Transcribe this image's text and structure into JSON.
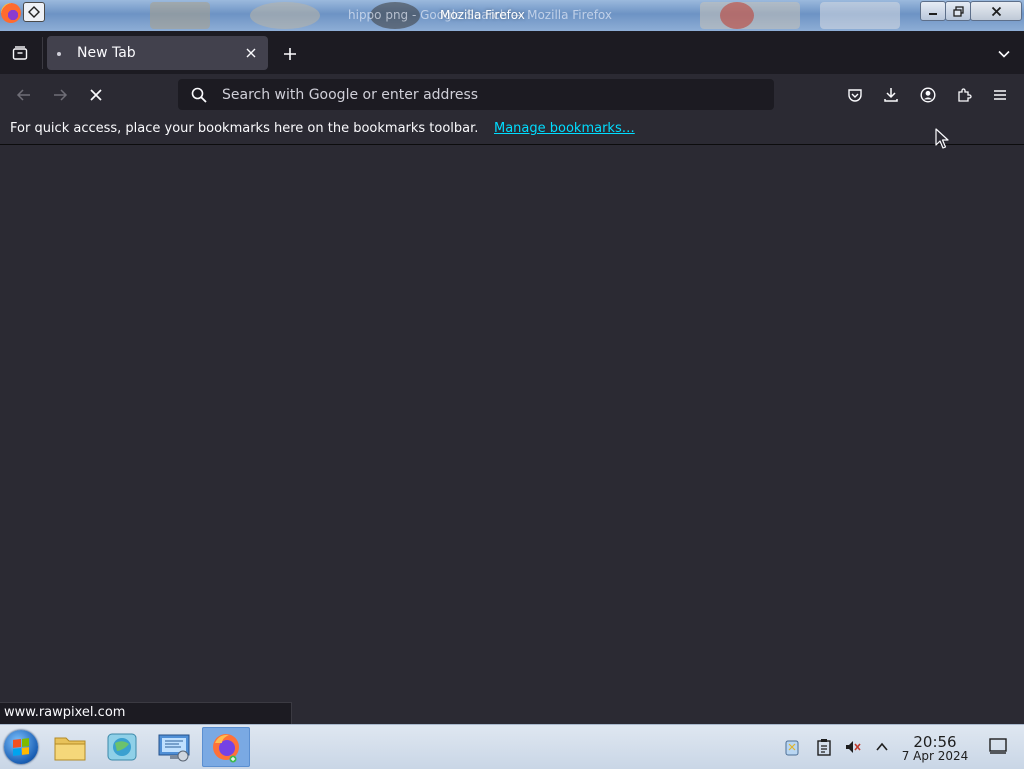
{
  "window": {
    "title_ghost": "hippo png - Google Search — Mozilla Firefox",
    "title": "Mozilla Firefox"
  },
  "tabs": [
    {
      "label": "New Tab",
      "active": true
    }
  ],
  "urlbar": {
    "placeholder": "Search with Google or enter address",
    "value": ""
  },
  "bookmarks_bar": {
    "hint": "For quick access, place your bookmarks here on the bookmarks toolbar.",
    "link": "Manage bookmarks…"
  },
  "status": {
    "url": "www.rawpixel.com"
  },
  "taskbar": {
    "apps": [
      "file-manager-icon",
      "browser-globe-icon",
      "control-panel-icon",
      "firefox-icon"
    ],
    "clock": {
      "time": "20:56",
      "date": "7 Apr 2024"
    }
  },
  "colors": {
    "toolbar": "#2b2a33",
    "tabstrip": "#1c1b22",
    "active_tab": "#42414d",
    "link": "#00ddff",
    "titlebar": "#6d93c4"
  }
}
